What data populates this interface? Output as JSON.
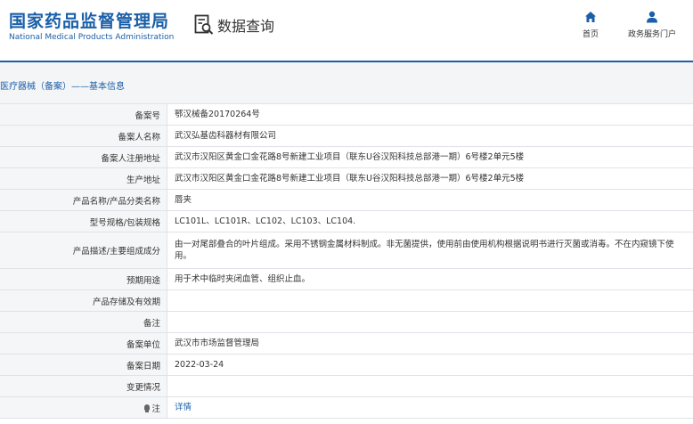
{
  "header": {
    "logo_cn": "国家药品监督管理局",
    "logo_en": "National Medical Products Administration",
    "query_label": "数据查询",
    "nav": {
      "home": "首页",
      "service": "政务服务门户"
    }
  },
  "breadcrumb": "医疗器械（备案）——基本信息",
  "rows": [
    {
      "label": "备案号",
      "value": "鄂汉械备20170264号"
    },
    {
      "label": "备案人名称",
      "value": "武汉弘基齿科器材有限公司"
    },
    {
      "label": "备案人注册地址",
      "value": "武汉市汉阳区黄金口金花路8号新建工业项目（联东U谷汉阳科技总部港一期）6号楼2单元5楼"
    },
    {
      "label": "生产地址",
      "value": "武汉市汉阳区黄金口金花路8号新建工业项目（联东U谷汉阳科技总部港一期）6号楼2单元5楼"
    },
    {
      "label": "产品名称/产品分类名称",
      "value": "唇夹"
    },
    {
      "label": "型号规格/包装规格",
      "value": "LC101L、LC101R、LC102、LC103、LC104."
    },
    {
      "label": "产品描述/主要组成成分",
      "value": "由一对尾部叠合的叶片组成。采用不锈钢金属材料制成。非无菌提供，使用前由使用机构根据说明书进行灭菌或消毒。不在内窥镜下使用。"
    },
    {
      "label": "预期用途",
      "value": "用于术中临时夹闭血管、组织止血。"
    },
    {
      "label": "产品存储及有效期",
      "value": ""
    },
    {
      "label": "备注",
      "value": ""
    },
    {
      "label": "备案单位",
      "value": "武汉市市场监督管理局"
    },
    {
      "label": "备案日期",
      "value": "2022-03-24"
    },
    {
      "label": "变更情况",
      "value": ""
    }
  ],
  "note_row": {
    "label": "注",
    "link": "详情"
  }
}
